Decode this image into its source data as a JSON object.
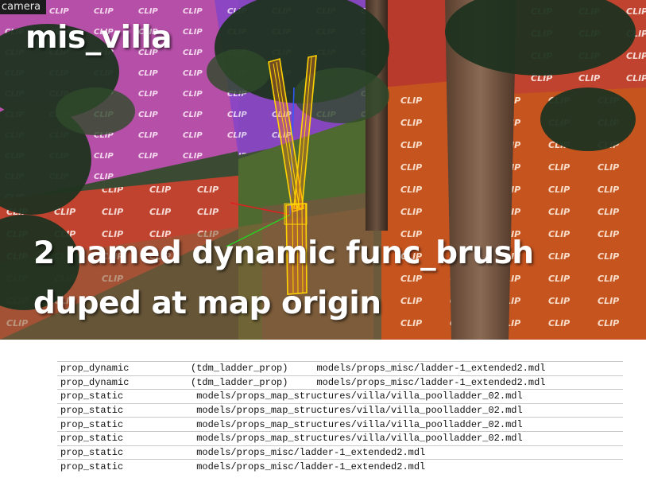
{
  "viewport": {
    "camera_label": "camera",
    "map_title": "mis_villa",
    "caption_lines": [
      "2 named dynamic func_brush",
      "duped at map origin"
    ],
    "texture_label": "CLIP",
    "colors": {
      "pink_wall": "#b54fa7",
      "violet_wall": "#8a46c4",
      "red_wall": "#c0432f",
      "orange_wall": "#c6541f",
      "brush_outline": "#ffd400",
      "brush_fill": "#ff7a1a"
    }
  },
  "entity_list": {
    "rows": [
      {
        "classname": "prop_dynamic",
        "target": "(tdm_ladder_prop)",
        "model": "models/props_misc/ladder-1_extended2.mdl"
      },
      {
        "classname": "prop_dynamic",
        "target": "(tdm_ladder_prop)",
        "model": "models/props_misc/ladder-1_extended2.mdl"
      },
      {
        "classname": "prop_static",
        "target": "",
        "model": "models/props_map_structures/villa/villa_poolladder_02.mdl"
      },
      {
        "classname": "prop_static",
        "target": "",
        "model": "models/props_map_structures/villa/villa_poolladder_02.mdl"
      },
      {
        "classname": "prop_static",
        "target": "",
        "model": "models/props_map_structures/villa/villa_poolladder_02.mdl"
      },
      {
        "classname": "prop_static",
        "target": "",
        "model": "models/props_map_structures/villa/villa_poolladder_02.mdl"
      },
      {
        "classname": "prop_static",
        "target": "",
        "model": "models/props_misc/ladder-1_extended2.mdl"
      },
      {
        "classname": "prop_static",
        "target": "",
        "model": "models/props_misc/ladder-1_extended2.mdl"
      }
    ]
  }
}
